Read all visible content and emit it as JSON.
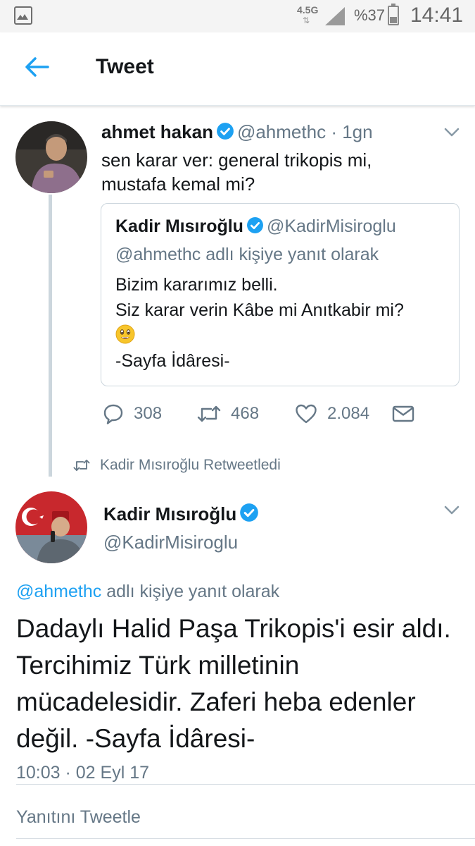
{
  "status_bar": {
    "network": "4.5G",
    "battery_percent": "%37",
    "battery_level": 0.37,
    "time": "14:41",
    "icons": [
      "gallery-icon",
      "data-arrows-icon",
      "signal-icon",
      "battery-icon"
    ]
  },
  "header": {
    "title": "Tweet",
    "back_icon": "back-arrow-icon"
  },
  "tweet1": {
    "name": "ahmet hakan",
    "handle": "@ahmethc",
    "separator": "·",
    "age": "1gn",
    "text_line1": "sen karar ver: general trikopis mi,",
    "text_line2": "mustafa kemal mi?",
    "quote": {
      "name": "Kadir Mısıroğlu",
      "handle": "@KadirMisiroglu",
      "reply_context": "@ahmethc adlı kişiye yanıt olarak",
      "line1": "Bizim kararımız belli.",
      "line2": "Siz karar verin Kâbe mi Anıtkabir mi?",
      "line4": "-Sayfa İdâresi-",
      "emoji": "surprised-face-emoji"
    },
    "actions": {
      "replies": "308",
      "retweets": "468",
      "likes": "2.084"
    }
  },
  "retweet_context": "Kadir Mısıroğlu Retweetledi",
  "tweet2": {
    "name": "Kadir Mısıroğlu",
    "handle": "@KadirMisiroglu",
    "reply_handle": "@ahmethc",
    "reply_suffix": " adlı kişiye yanıt olarak",
    "body": "Dadaylı Halid Paşa Trikopis'i esir aldı. Tercihimiz Türk milletinin mücadelesidir. Zaferi heba edenler değil. -Sayfa İdâresi-",
    "timestamp": "10:03 · 02 Eyl 17"
  },
  "reply_prompt": "Yanıtını Tweetle",
  "colors": {
    "accent": "#1da1f2",
    "muted": "#657786",
    "text": "#14171a",
    "border": "#ccd6dd"
  }
}
